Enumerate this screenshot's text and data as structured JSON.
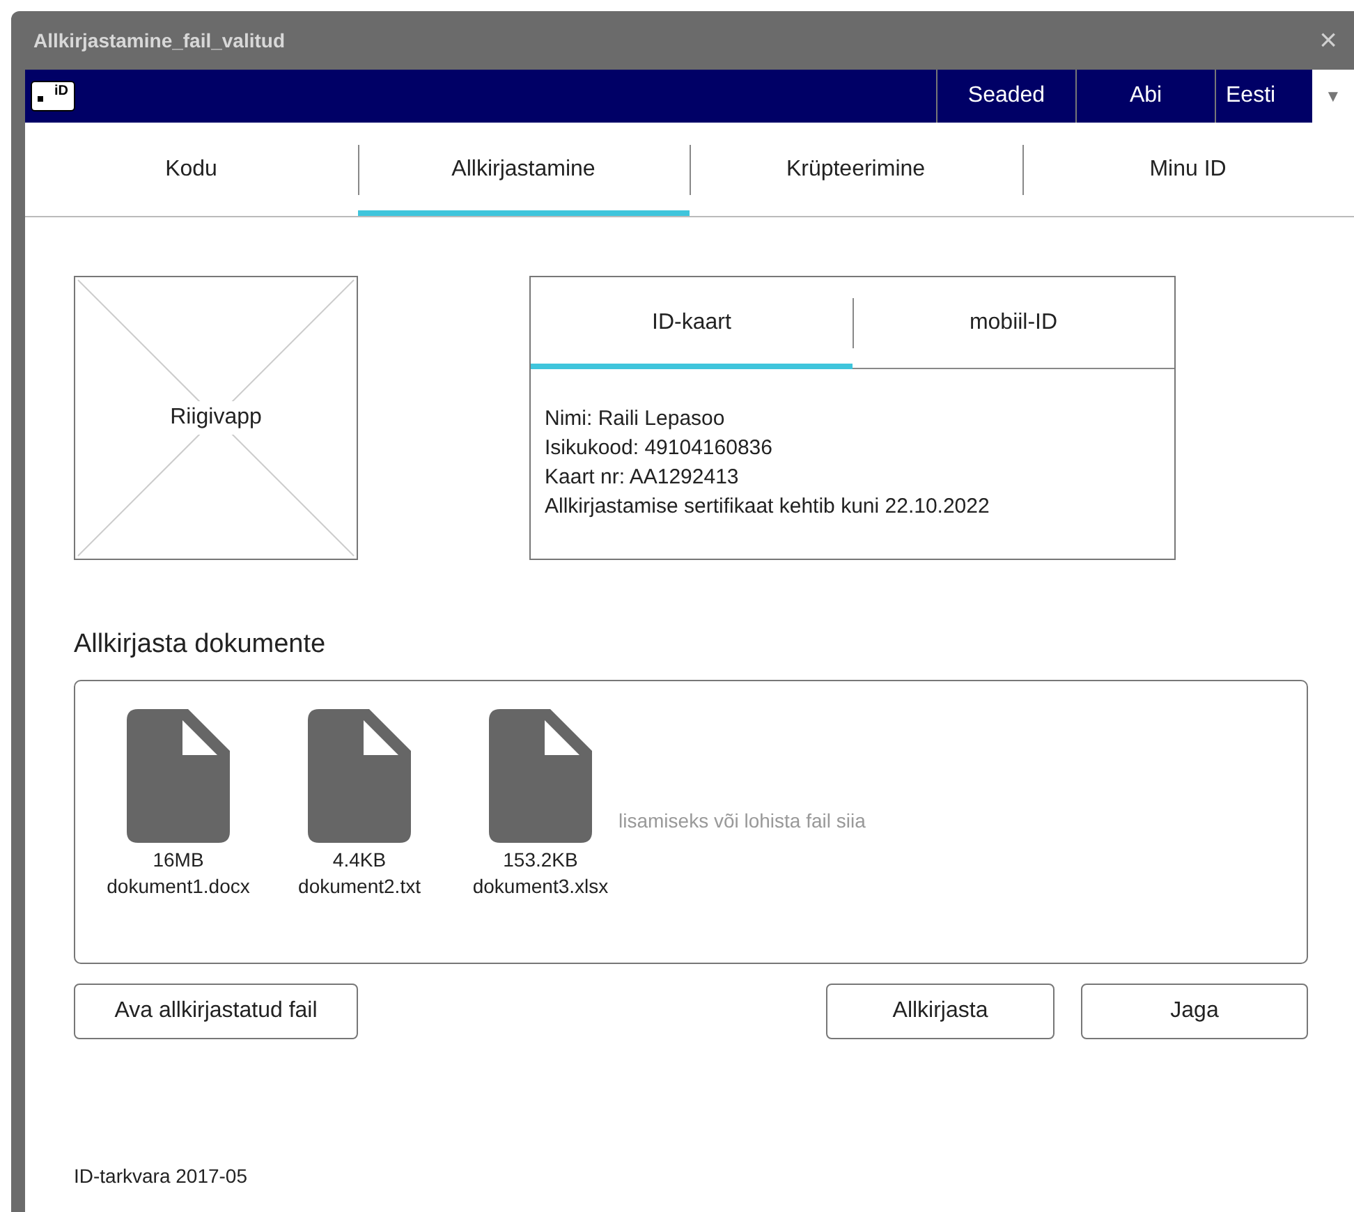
{
  "window": {
    "title": "Allkirjastamine_fail_valitud",
    "close": "×"
  },
  "topbar": {
    "logo": "iD",
    "items": [
      {
        "label": "Seaded"
      },
      {
        "label": "Abi"
      }
    ],
    "language": "Eesti",
    "dropdown": "▼"
  },
  "tabs": [
    {
      "label": "Kodu",
      "selected": false
    },
    {
      "label": "Allkirjastamine",
      "selected": true
    },
    {
      "label": "Krüpteerimine",
      "selected": false
    },
    {
      "label": "Minu ID",
      "selected": false
    }
  ],
  "image_placeholder": {
    "label": "Riigivapp"
  },
  "card": {
    "tabs": [
      {
        "label": "ID-kaart",
        "selected": true
      },
      {
        "label": "mobiil-ID",
        "selected": false
      }
    ],
    "lines": [
      "Nimi: Raili Lepasoo",
      "Isikukood: 49104160836",
      "Kaart nr: AA1292413",
      "Allkirjastamise sertifikaat kehtib kuni 22.10.2022"
    ]
  },
  "section_title": "Allkirjasta dokumente",
  "dropzone": {
    "files": [
      {
        "size": "16MB",
        "name": "dokument1.docx"
      },
      {
        "size": "4.4KB",
        "name": "dokument2.txt"
      },
      {
        "size": "153.2KB",
        "name": "dokument3.xlsx"
      }
    ],
    "hint": "lisamiseks või lohista fail siia"
  },
  "buttons": {
    "open": "Ava allkirjastatud fail",
    "sign": "Allkirjasta",
    "share": "Jaga"
  },
  "footer": "ID-tarkvara 2017-05"
}
